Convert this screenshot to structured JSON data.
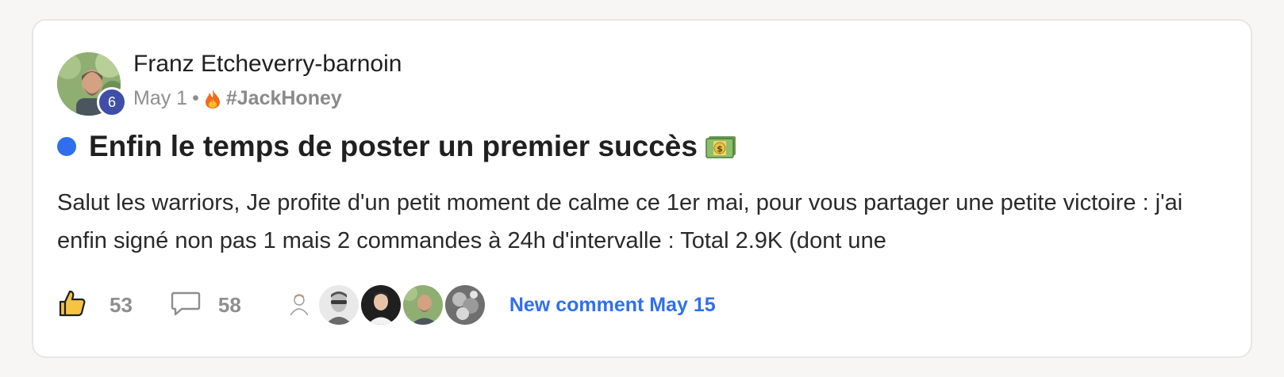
{
  "post": {
    "author": "Franz Etcheverry-barnoin",
    "level": "6",
    "date": "May 1",
    "separator": "•",
    "category": "#JackHoney",
    "category_icon": "flame-icon",
    "title": "Enfin le temps de poster un premier succès",
    "title_icon": "money-bill-icon",
    "body": "Salut les warriors, Je profite d'un petit moment de calme ce 1er mai, pour vous partager une petite victoire : j'ai enfin signé non pas 1 mais 2 commandes à 24h d'intervalle : Total 2.9K (dont une"
  },
  "footer": {
    "likes": "53",
    "comments": "58",
    "new_comment": "New comment May 15"
  },
  "colors": {
    "accent": "#2f6fee",
    "level_badge": "#3f4fa8",
    "muted": "#8e8e8e"
  }
}
